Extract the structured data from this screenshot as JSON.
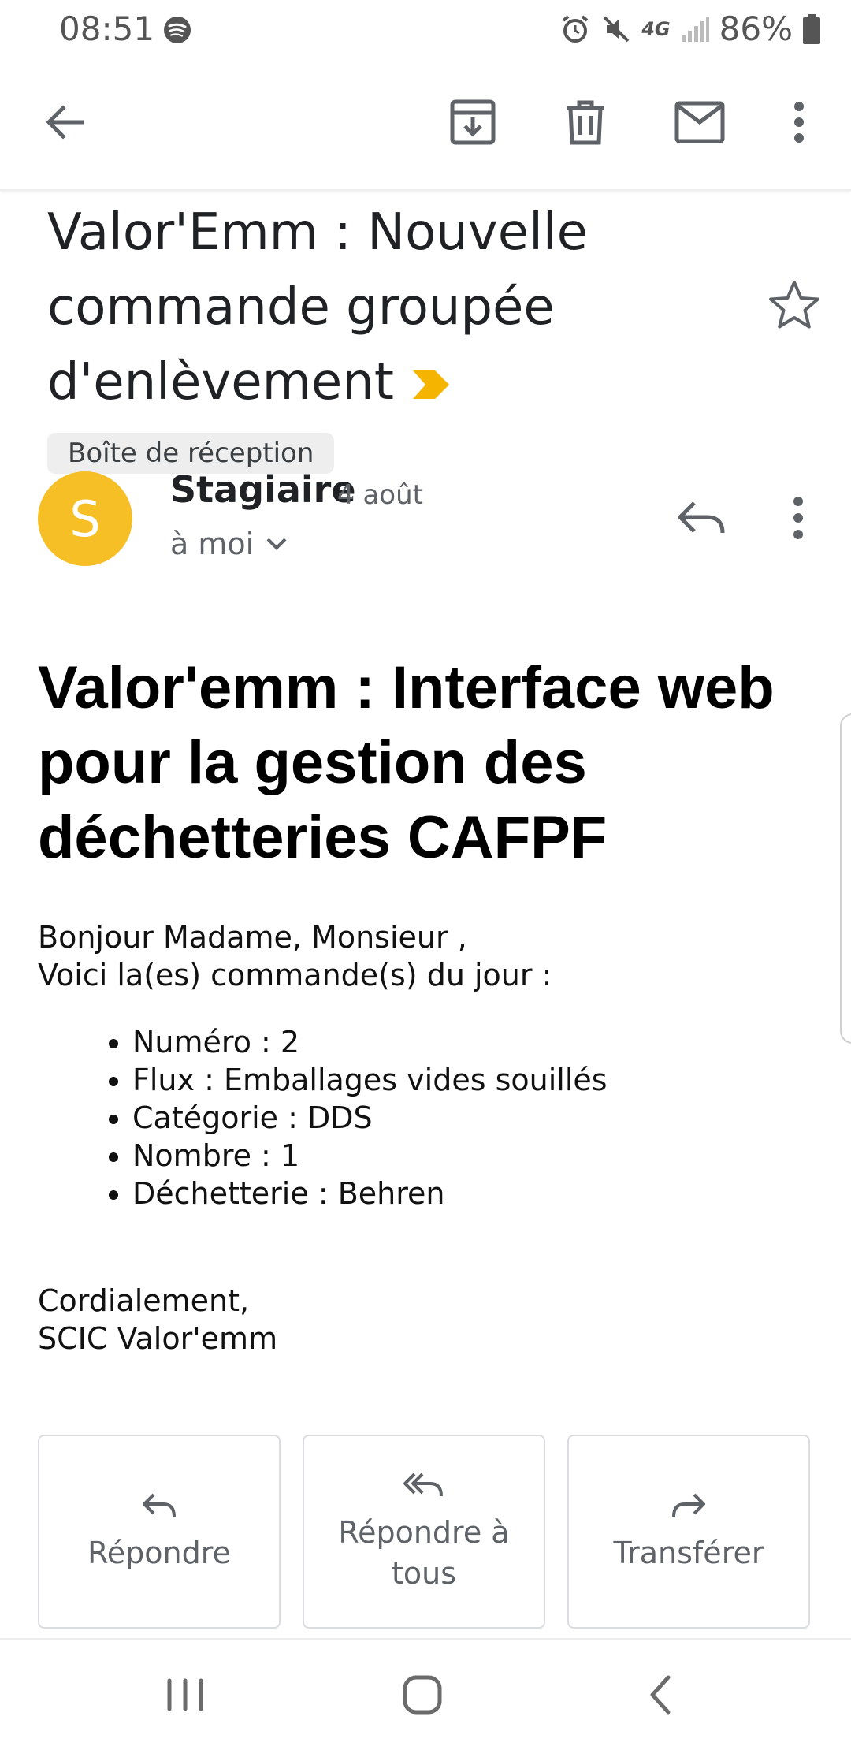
{
  "status_bar": {
    "time": "08:51",
    "battery": "86%",
    "network": "4G"
  },
  "toolbar": {
    "back": "arrow-back-icon",
    "archive": "archive-icon",
    "delete": "trash-icon",
    "mark_unread": "mail-icon",
    "more": "more-vert-icon"
  },
  "email": {
    "subject": "Valor'Emm : Nouvelle commande groupée d'enlèvement",
    "label": "Boîte de réception",
    "sender": {
      "initial": "S",
      "name": "Stagiaire",
      "date": "4 août",
      "recipient": "à moi",
      "avatar_color": "#F6BF26"
    },
    "body": {
      "title": "Valor'emm : Interface web pour la gestion des déchetteries CAFPF",
      "greeting": "Bonjour Madame, Monsieur ,",
      "intro": "Voici la(es) commande(s) du jour :",
      "items": [
        "Numéro : 2",
        "Flux : Emballages vides souillés",
        "Catégorie : DDS",
        "Nombre : 1",
        "Déchetterie : Behren"
      ],
      "closing": "Cordialement,",
      "signature": "SCIC Valor'emm"
    }
  },
  "actions": {
    "reply": "Répondre",
    "reply_all": "Répondre à tous",
    "forward": "Transférer"
  },
  "colors": {
    "importance": "#F4B400",
    "icon_gray": "#5f6368"
  }
}
